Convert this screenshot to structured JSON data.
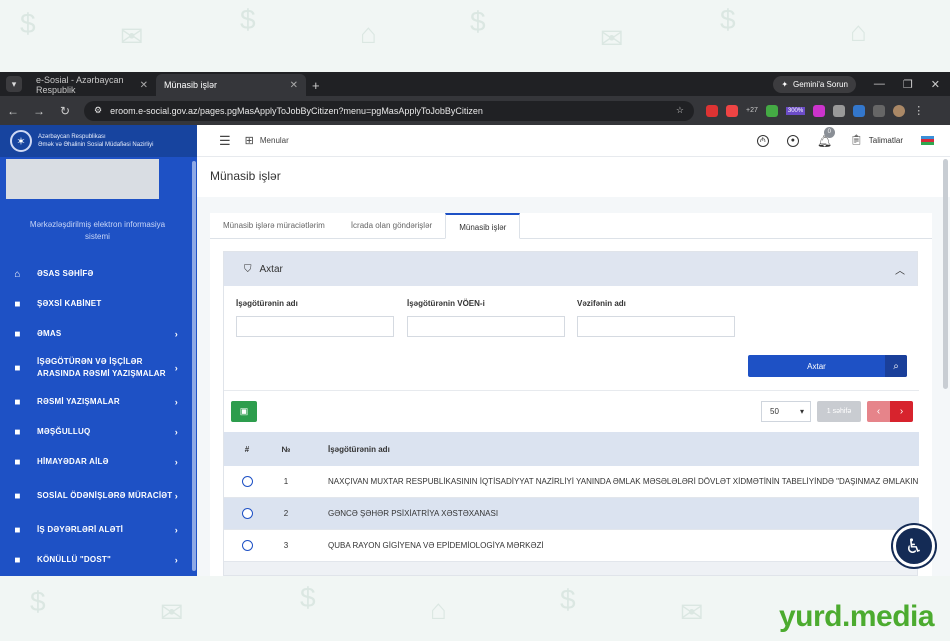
{
  "browser": {
    "tabs": [
      {
        "title": "e-Sosial - Azərbaycan Respublik",
        "active": false
      },
      {
        "title": "Münasib işlər",
        "active": true
      }
    ],
    "gemini_label": "Gemini'a Sorun",
    "url": "eroom.e-social.gov.az/pages.pgMasApplyToJobByCitizen?menu=pgMasApplyToJobByCitizen",
    "ext_badges": [
      "+27",
      "300%"
    ]
  },
  "sidebar": {
    "org_name_line1": "Azərbaycan Respublikası",
    "org_name_line2": "Əmək və Əhalinin Sosial Müdafiəsi Nazirliyi",
    "note": "Mərkəzləşdirilmiş elektron informasiya sistemi",
    "items": [
      {
        "label": "ƏSAS SƏHİFƏ",
        "icon": "home-icon",
        "chevron": false
      },
      {
        "label": "ŞƏXSİ KABİNET",
        "icon": "folder-icon",
        "chevron": false
      },
      {
        "label": "ƏMAS",
        "icon": "folder-icon",
        "chevron": true
      },
      {
        "label": "İŞƏGÖTÜRƏN VƏ İŞÇİLƏR ARASINDA RƏSMİ YAZIŞMALAR",
        "icon": "folder-icon",
        "chevron": true
      },
      {
        "label": "RƏSMİ YAZIŞMALAR",
        "icon": "folder-icon",
        "chevron": true
      },
      {
        "label": "MƏŞĞULLUQ",
        "icon": "folder-icon",
        "chevron": true
      },
      {
        "label": "HİMAYƏDAR AİLƏ",
        "icon": "folder-icon",
        "chevron": true
      },
      {
        "label": "SOSİAL ÖDƏNİŞLƏRƏ MÜRACİƏT",
        "icon": "folder-icon",
        "chevron": true
      },
      {
        "label": "İŞ DƏYƏRLƏRİ ALƏTİ",
        "icon": "folder-icon",
        "chevron": true
      },
      {
        "label": "KÖNÜLLÜ \"DOST\"",
        "icon": "folder-icon",
        "chevron": true
      }
    ]
  },
  "topbar": {
    "menular": "Menular",
    "notif_count": "0",
    "telimatlar": "Talimatlar"
  },
  "page": {
    "title": "Münasib işlər",
    "tabs": [
      {
        "label": "Münasib işlərə müraciətlərim",
        "active": false
      },
      {
        "label": "İcrada olan göndərişlər",
        "active": false
      },
      {
        "label": "Münasib işlər",
        "active": true
      }
    ]
  },
  "search": {
    "header": "Axtar",
    "fields": [
      {
        "label": "İşəgötürənin adı",
        "value": ""
      },
      {
        "label": "İşəgötürənin VÖEN-i",
        "value": ""
      },
      {
        "label": "Vəzifənin adı",
        "value": ""
      }
    ],
    "button": "Axtar"
  },
  "pager": {
    "page_size": "50",
    "page_info": "1 səhifə"
  },
  "table": {
    "headers": [
      "#",
      "№",
      "İşəgötürənin adı"
    ],
    "rows": [
      {
        "no": "1",
        "name": "NAXÇIVAN MUXTAR RESPUBLİKASININ İQTİSADİYYAT NAZİRLİYİ YANINDA ƏMLAK MƏSƏLƏLƏRİ DÖVLƏT XİDMƏTİNİN TABELİYİNDƏ \"DAŞINMAZ ƏMLAKIN DÖ"
      },
      {
        "no": "2",
        "name": "GƏNCƏ ŞƏHƏR PSİXİATRİYA XƏSTƏXANASI"
      },
      {
        "no": "3",
        "name": "QUBA RAYON GİGİYENA VƏ EPİDEMİOLOGİYA MƏRKƏZİ"
      }
    ]
  },
  "watermark": "yurd.media",
  "colors": {
    "primary": "#1e51c5",
    "danger": "#d7232d",
    "excel": "#2d9d4d",
    "watermark": "#4cab2f"
  }
}
